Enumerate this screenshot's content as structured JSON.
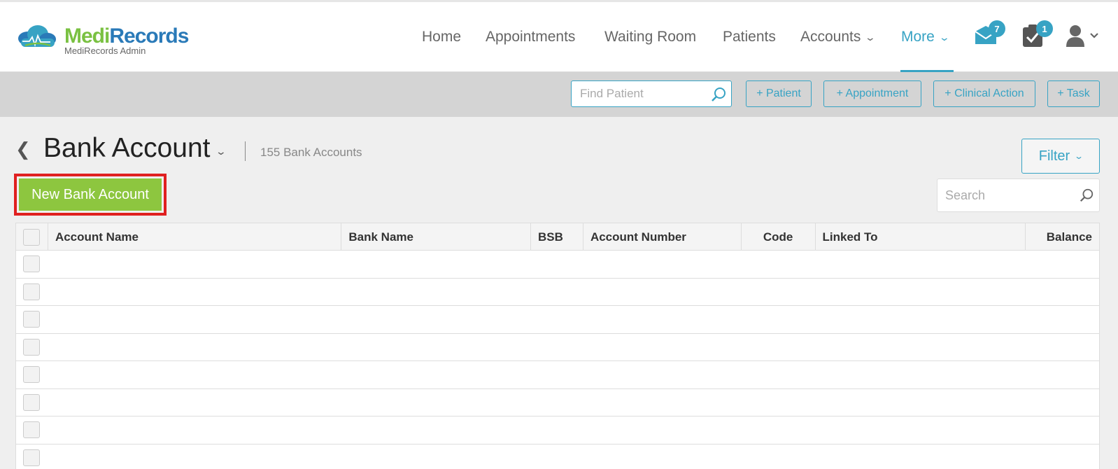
{
  "brand": {
    "name_part1": "Medi",
    "name_part2": "Records",
    "subtitle": "MediRecords Admin",
    "green": "#7ac142",
    "blue": "#2a7ab8"
  },
  "nav": {
    "items": [
      {
        "label": "Home"
      },
      {
        "label": "Appointments"
      },
      {
        "label": "Waiting Room"
      },
      {
        "label": "Patients"
      },
      {
        "label": "Accounts",
        "dropdown": true
      },
      {
        "label": "More",
        "dropdown": true,
        "active": true
      }
    ],
    "messages_badge": "7",
    "tasks_badge": "1",
    "accent": "#37a3c4"
  },
  "toolbar": {
    "find_placeholder": "Find Patient",
    "buttons": [
      "+ Patient",
      "+ Appointment",
      "+ Clinical Action",
      "+ Task"
    ]
  },
  "page": {
    "title": "Bank Account",
    "count": "155 Bank Accounts",
    "filter_label": "Filter",
    "new_button": "New Bank Account",
    "search_placeholder": "Search"
  },
  "table": {
    "columns": [
      "Account Name",
      "Bank Name",
      "BSB",
      "Account Number",
      "Code",
      "Linked To",
      "Balance"
    ],
    "rows": [
      {},
      {},
      {},
      {},
      {},
      {},
      {},
      {}
    ]
  }
}
